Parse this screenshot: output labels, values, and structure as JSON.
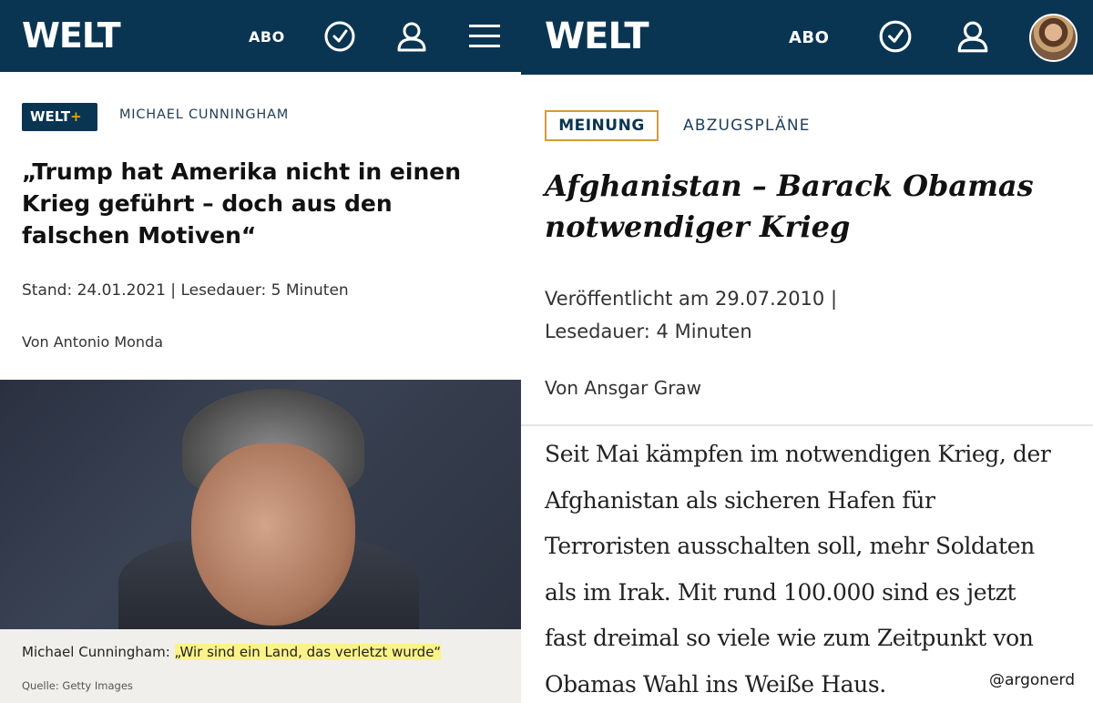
{
  "left": {
    "header": {
      "logo": "WELT",
      "abo": "ABO",
      "icons": [
        "clock-check-icon",
        "user-icon",
        "hamburger-menu-icon"
      ],
      "bar_color": "#0a3552"
    },
    "article": {
      "badge_text": "WELT",
      "badge_plus": "+",
      "kicker": "MICHAEL CUNNINGHAM",
      "headline": "„Trump hat Amerika nicht in einen Krieg geführt – doch aus den falschen Motiven“",
      "meta": "Stand: 24.01.2021 | Lesedauer: 5 Minuten",
      "byline": "Von Antonio Monda",
      "caption_prefix": "Michael Cunningham: ",
      "caption_quote": "„Wir sind ein Land, das verletzt wurde“",
      "source": "Quelle: Getty Images"
    }
  },
  "right": {
    "header": {
      "logo": "WELT",
      "abo": "ABO",
      "icons": [
        "clock-check-icon",
        "user-icon",
        "avatar"
      ]
    },
    "article": {
      "badge": "MEINUNG",
      "kicker": "ABZUGSPLÄNE",
      "headline_lines": [
        "Afghanistan – Barack Obamas",
        "notwendiger Krieg"
      ],
      "meta_lines": [
        "Veröffentlicht am 29.07.2010 |",
        "Lesedauer: 4 Minuten"
      ],
      "byline": "Von Ansgar Graw",
      "body_lines": [
        "Seit Mai kämpfen im notwendigen Krieg, der",
        "Afghanistan als sicheren Hafen für",
        "Terroristen ausschalten soll, mehr Soldaten",
        "als im Irak. Mit rund 100.000 sind es jetzt",
        "fast dreimal so viele wie zum Zeitpunkt von",
        "Obamas Wahl ins Weiße Haus."
      ]
    }
  },
  "watermark": "@argonerd",
  "colors": {
    "navy": "#0a3552",
    "gold_border": "#d39b3f",
    "plus_orange": "#f0a000",
    "highlight": "#fbf38a"
  }
}
